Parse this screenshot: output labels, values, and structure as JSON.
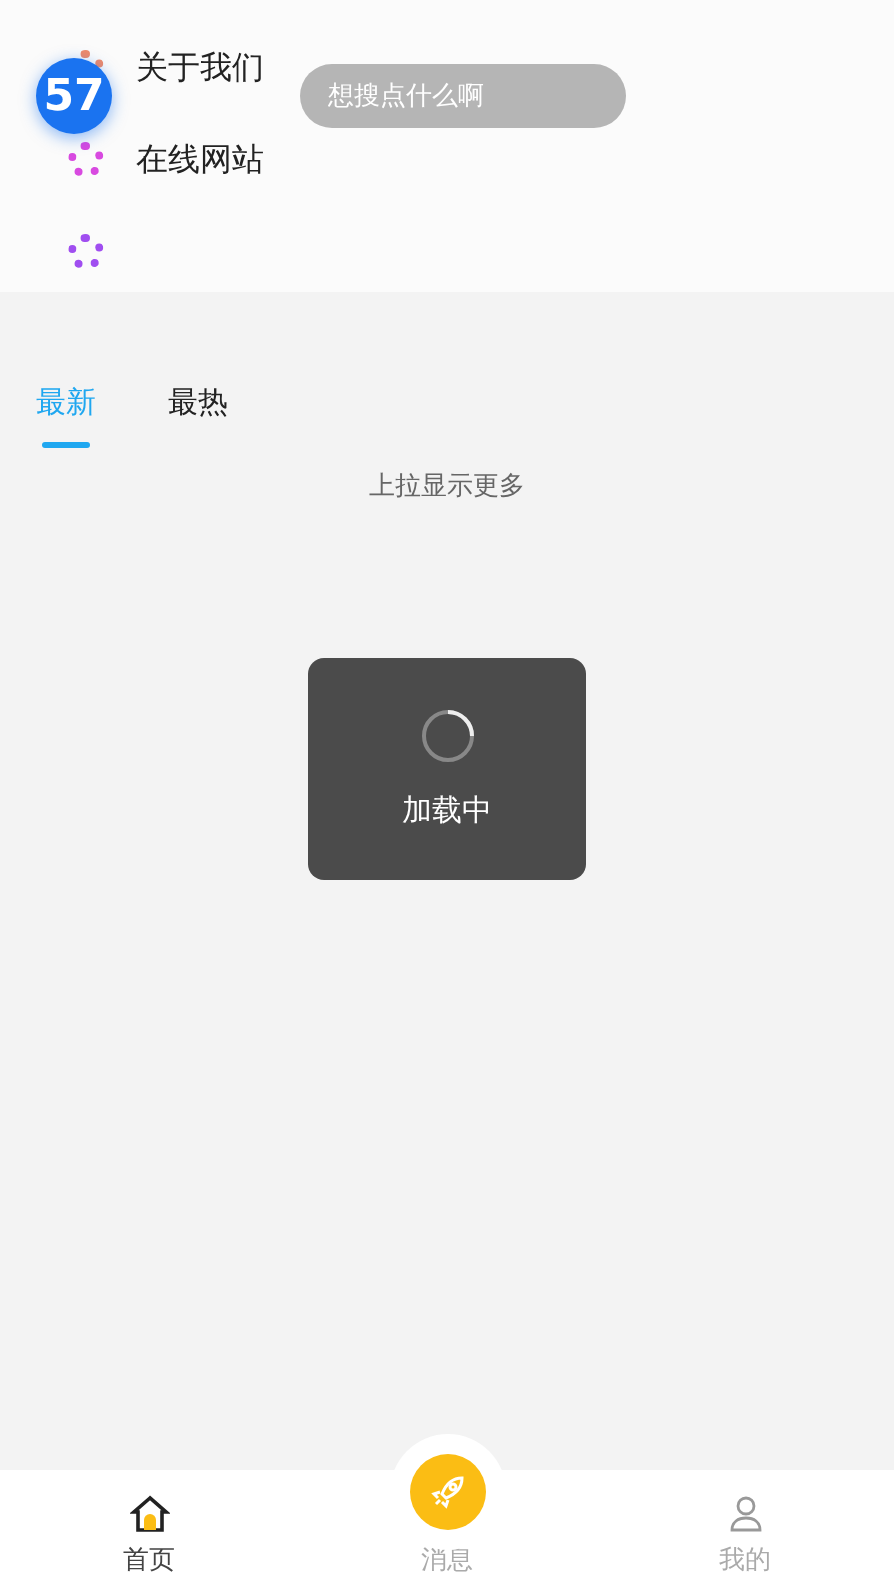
{
  "header": {
    "badge": "57",
    "search": {
      "placeholder": "想搜点什么啊"
    },
    "menu": [
      {
        "label": "关于我们",
        "color": "#f08a6a"
      },
      {
        "label": "在线网站",
        "color": "#d84ae0"
      },
      {
        "color": "#a04ef0"
      }
    ]
  },
  "tabs": [
    {
      "label": "最新",
      "selected": true
    },
    {
      "label": "最热",
      "selected": false
    }
  ],
  "hint": "上拉显示更多",
  "toast": {
    "text": "加载中"
  },
  "nav": [
    {
      "label": "首页",
      "kind": "home",
      "selected": true
    },
    {
      "label": "消息",
      "kind": "rocket",
      "selected": false
    },
    {
      "label": "我的",
      "kind": "user",
      "selected": false
    }
  ]
}
